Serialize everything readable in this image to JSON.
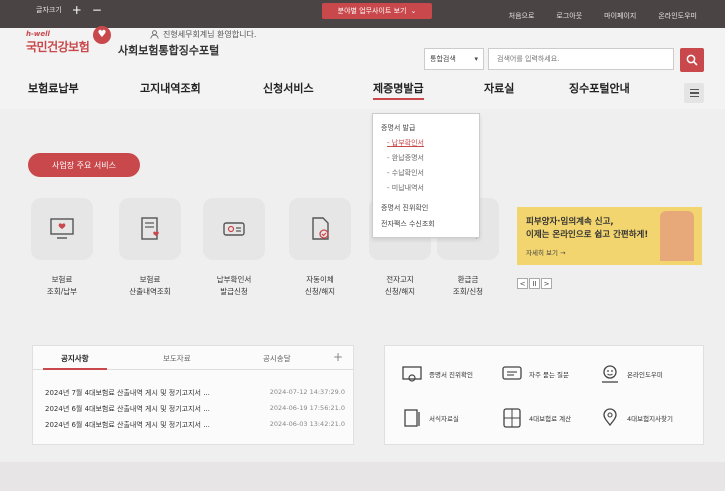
{
  "topbar": {
    "font_size_label": "글자크기",
    "plus": "+",
    "minus": "−",
    "biz_site_label": "분야별 업무사이트 보기",
    "links": [
      "처음으로",
      "로그아웃",
      "마이페이지",
      "온라인도우미"
    ]
  },
  "header": {
    "logo_hwell": "h-well",
    "logo_name": "국민건강보험",
    "portal_title": "사회보험통합징수포털",
    "welcome": "진형세무회계님 환영합니다.",
    "search_type": "통합검색",
    "search_placeholder": "검색어를 입력하세요."
  },
  "nav": {
    "items": [
      "보험료납부",
      "고지내역조회",
      "신청서비스",
      "제증명발급",
      "자료실",
      "징수포털안내"
    ],
    "active": "제증명발급"
  },
  "dropdown": {
    "group1_title": "증명서 발급",
    "group1_items": [
      "납부확인서",
      "완납증명서",
      "수납확인서",
      "미납내역서"
    ],
    "item2": "증명서 진위확인",
    "item3": "전자팩스 수신조회"
  },
  "service_button": "사업장 주요 서비스",
  "quick": [
    {
      "line1": "보험료",
      "line2": "조회/납부",
      "icon": "monitor-heart-icon"
    },
    {
      "line1": "보험료",
      "line2": "산출내역조회",
      "icon": "document-heart-icon"
    },
    {
      "line1": "납부확인서",
      "line2": "발급신청",
      "icon": "printer-icon"
    },
    {
      "line1": "자동이체",
      "line2": "신청/해지",
      "icon": "document-check-icon"
    },
    {
      "line1": "전자고지",
      "line2": "신청/해지",
      "icon": "laptop-icon"
    },
    {
      "line1": "환급금",
      "line2": "조회/신청",
      "icon": "search-coin-icon"
    }
  ],
  "banner": {
    "line1": "피부양자·임의계속 신고,",
    "line2": "이제는 온라인으로 쉽고 간편하게!",
    "more": "자세히 보기 →"
  },
  "pager": [
    "<",
    "II",
    ">"
  ],
  "notice": {
    "tabs": [
      "공지사항",
      "보도자료",
      "공시송달"
    ],
    "plus": "+",
    "rows": [
      {
        "title": "2024년 7월 4대보험료 산출내역 게시 및 정기고지서 ...",
        "date": "2024-07-12 14:37:29.0"
      },
      {
        "title": "2024년 6월 4대보험료 산출내역 게시 및 정기고지서 ...",
        "date": "2024-06-19 17:56:21.0"
      },
      {
        "title": "2024년 6월 4대보험료 산출내역 게시 및 정기고지서 ...",
        "date": "2024-06-03 13:42:21.0"
      }
    ]
  },
  "services": [
    {
      "label": "증명서 진위확인",
      "icon": "certificate-icon"
    },
    {
      "label": "자주 묻는 질문",
      "icon": "chat-icon"
    },
    {
      "label": "온라인도우미",
      "icon": "helper-icon"
    },
    {
      "label": "서식자료실",
      "icon": "book-icon"
    },
    {
      "label": "4대보험료 계산",
      "icon": "calculator-icon"
    },
    {
      "label": "4대보험지사찾기",
      "icon": "location-icon"
    }
  ],
  "colors": {
    "accent": "#c8484b",
    "banner": "#f2d56f",
    "topbar": "#4b4444"
  }
}
